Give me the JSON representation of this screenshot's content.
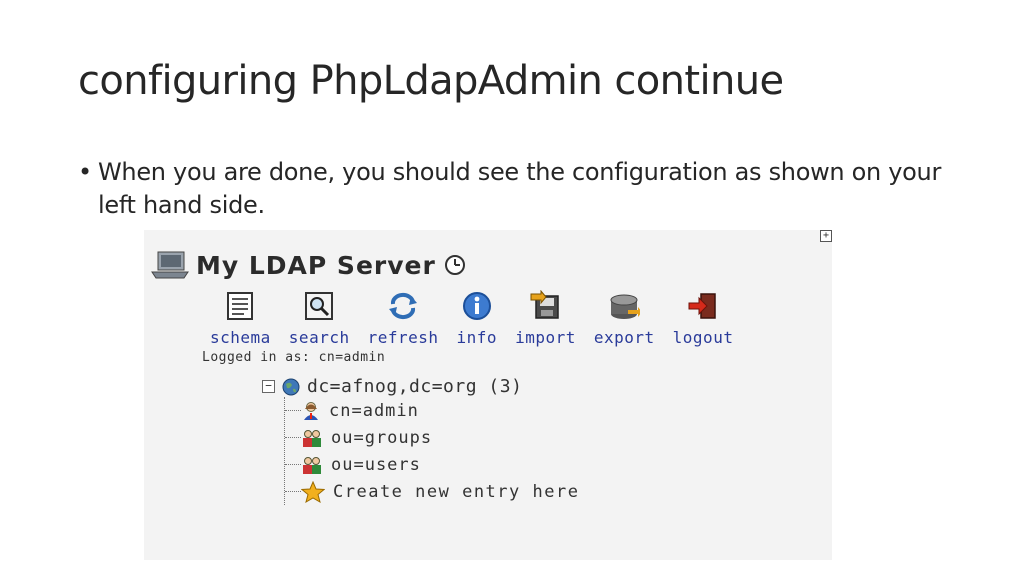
{
  "slide": {
    "title": "configuring PhpLdapAdmin continue",
    "bullet": "When you are done, you should see the configuration as shown on your left hand side."
  },
  "ldap_panel": {
    "server_name": "My LDAP Server",
    "toolbar": [
      {
        "label": "schema",
        "icon": "schema-icon"
      },
      {
        "label": "search",
        "icon": "search-icon"
      },
      {
        "label": "refresh",
        "icon": "refresh-icon"
      },
      {
        "label": "info",
        "icon": "info-icon"
      },
      {
        "label": "import",
        "icon": "import-icon"
      },
      {
        "label": "export",
        "icon": "export-icon"
      },
      {
        "label": "logout",
        "icon": "logout-icon"
      }
    ],
    "logged_in": "Logged in as: cn=admin",
    "tree": {
      "root": "dc=afnog,dc=org (3)",
      "children": [
        {
          "label": "cn=admin",
          "icon": "user-icon"
        },
        {
          "label": "ou=groups",
          "icon": "group-icon"
        },
        {
          "label": "ou=users",
          "icon": "group-icon"
        }
      ],
      "create": "Create new entry here"
    }
  },
  "colors": {
    "link": "#2a3b9a",
    "text": "#262626"
  }
}
